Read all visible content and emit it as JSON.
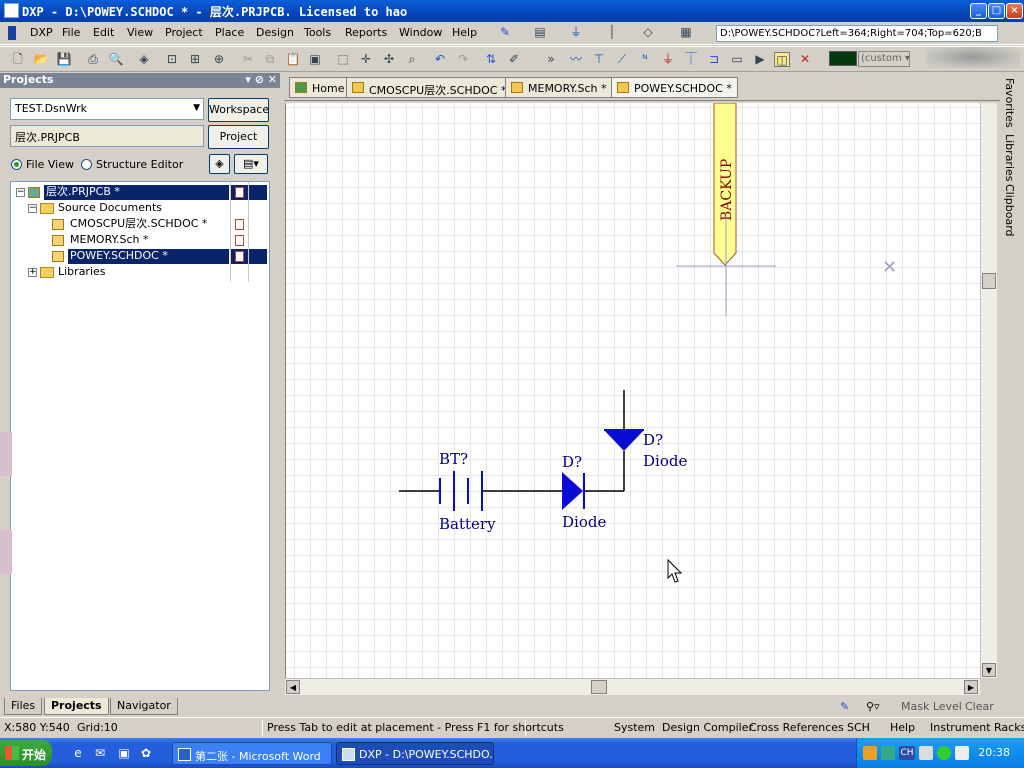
{
  "window": {
    "title": "DXP - D:\\POWEY.SCHDOC * - 层次.PRJPCB. Licensed to hao"
  },
  "menu": {
    "items": [
      "DXP",
      "File",
      "Edit",
      "View",
      "Project",
      "Place",
      "Design",
      "Tools",
      "Reports",
      "Window",
      "Help"
    ]
  },
  "toolbar": {
    "path_box": "D:\\POWEY.SCHDOC?Left=364;Right=704;Top=620;B",
    "custom_select": "(custom",
    "accent_color": "#06380e"
  },
  "projects_panel": {
    "title": "Projects",
    "workspace_combo": "TEST.DsnWrk",
    "workspace_button": "Workspace",
    "project_field": "层次.PRJPCB",
    "project_button": "Project",
    "file_view_label": "File View",
    "structure_editor_label": "Structure Editor",
    "tree": {
      "root": "层次.PRJPCB *",
      "source_documents": "Source Documents",
      "docs": [
        "CMOSCPU层次.SCHDOC *",
        "MEMORY.Sch *",
        "POWEY.SCHDOC *"
      ],
      "libraries": "Libraries"
    }
  },
  "bottom_tabs": [
    "Files",
    "Projects",
    "Navigator"
  ],
  "doc_tabs": [
    "Home",
    "CMOSCPU层次.SCHDOC *",
    "MEMORY.Sch *",
    "POWEY.SCHDOC *"
  ],
  "schematic": {
    "port_label": "BACKUP",
    "battery_designator": "BT?",
    "battery_comment": "Battery",
    "diode1_designator": "D?",
    "diode1_comment": "Diode",
    "diode2_designator": "D?",
    "diode2_comment": "Diode",
    "wire_color": "#000000",
    "part_color": "#0b0bd6",
    "text_color": "#000080",
    "port_fill": "#fffe90"
  },
  "right_strip": [
    "Favorites",
    "Libraries",
    "Clipboard"
  ],
  "status": {
    "mask_level": "Mask Level",
    "clear": "Clear",
    "coords": "X:580 Y:540",
    "grid": "Grid:10",
    "hint": "Press Tab to edit at placement - Press F1 for shortcuts",
    "panels": [
      "System",
      "Design Compiler",
      "Cross References",
      "SCH",
      "Help",
      "Instrument Racks"
    ]
  },
  "taskbar": {
    "start": "开始",
    "tasks": [
      "第二张 - Microsoft Word",
      "DXP - D:\\POWEY.SCHDO..."
    ],
    "clock": "20:38",
    "tray_lang": "CH"
  }
}
